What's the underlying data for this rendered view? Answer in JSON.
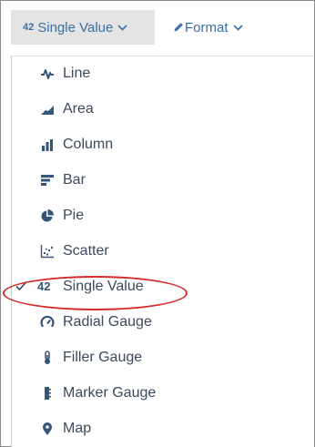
{
  "toolbar": {
    "viz_button": {
      "badge": "42",
      "label": "Single Value"
    },
    "format_button": {
      "label": "Format"
    }
  },
  "menu": {
    "items": [
      {
        "label": "Line",
        "icon": "line-chart-icon"
      },
      {
        "label": "Area",
        "icon": "area-chart-icon"
      },
      {
        "label": "Column",
        "icon": "column-chart-icon"
      },
      {
        "label": "Bar",
        "icon": "bar-chart-icon"
      },
      {
        "label": "Pie",
        "icon": "pie-chart-icon"
      },
      {
        "label": "Scatter",
        "icon": "scatter-chart-icon"
      },
      {
        "label": "Single Value",
        "icon": "single-value-icon",
        "badge": "42",
        "selected": true
      },
      {
        "label": "Radial Gauge",
        "icon": "radial-gauge-icon"
      },
      {
        "label": "Filler Gauge",
        "icon": "filler-gauge-icon"
      },
      {
        "label": "Marker Gauge",
        "icon": "marker-gauge-icon"
      },
      {
        "label": "Map",
        "icon": "map-pin-icon"
      }
    ]
  },
  "colors": {
    "accent": "#3a6ea5",
    "menu_text": "#3b4a5c",
    "icon": "#36557a",
    "highlight": "#d42a2a",
    "toolbar_active_bg": "#e4e4e4"
  }
}
